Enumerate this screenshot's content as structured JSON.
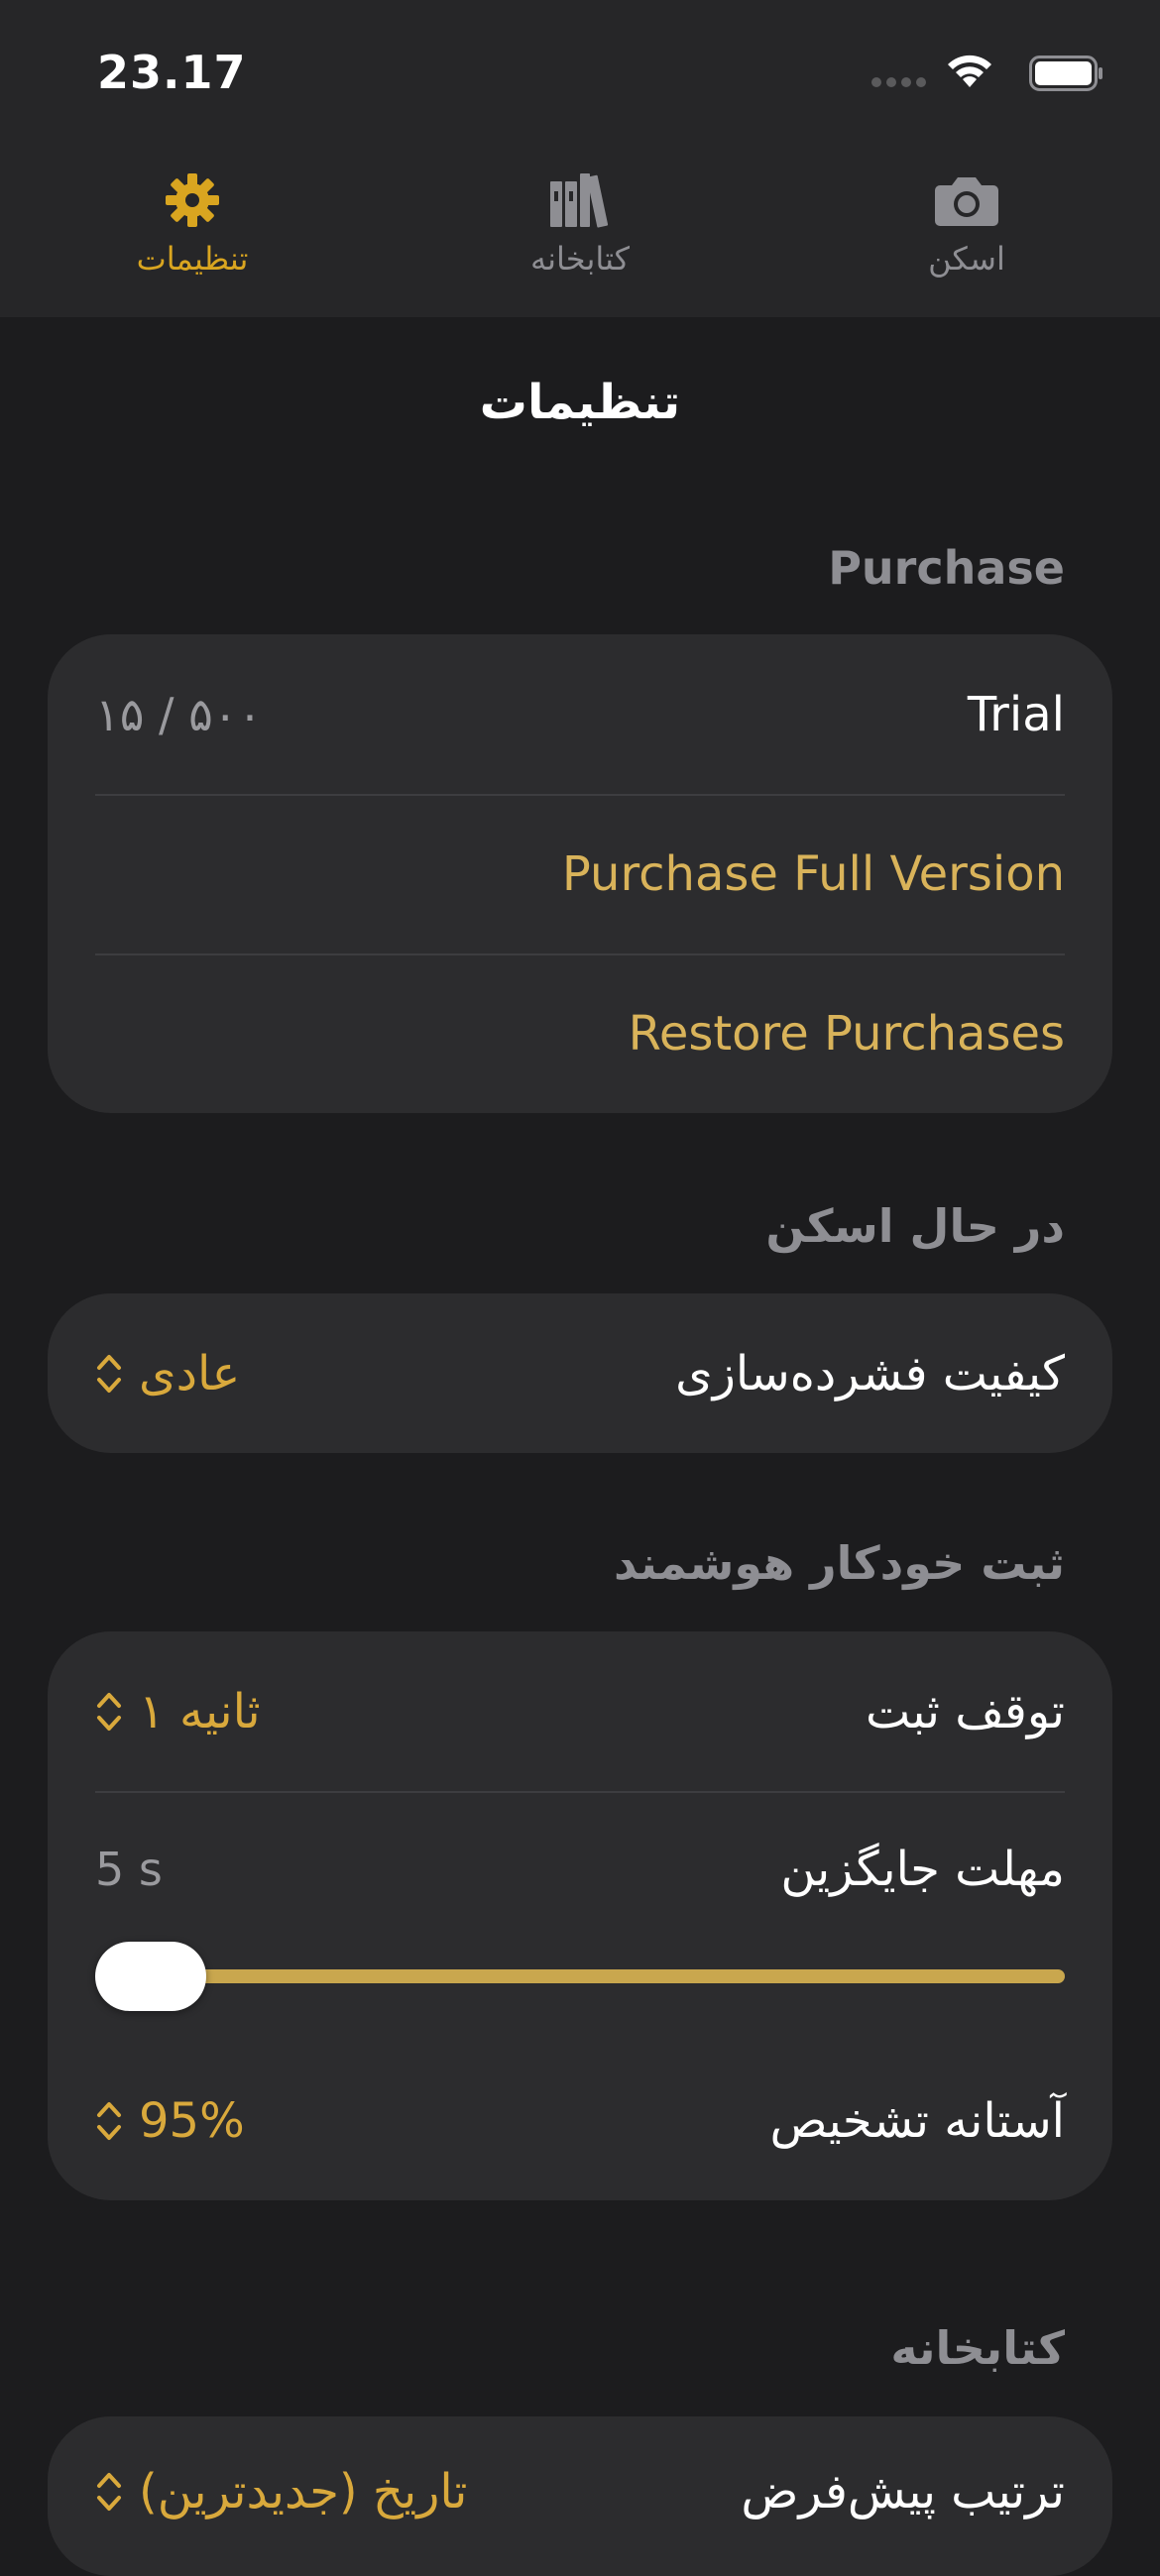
{
  "status_bar": {
    "time": "23.17"
  },
  "tabs": [
    {
      "label": "تنظیمات",
      "icon": "gear-icon",
      "active": true
    },
    {
      "label": "کتابخانه",
      "icon": "books-icon",
      "active": false
    },
    {
      "label": "اسکن",
      "icon": "camera-icon",
      "active": false
    }
  ],
  "page_title": "تنظیمات",
  "purchase": {
    "header": "Purchase",
    "trial_label": "Trial",
    "trial_count": "۱۵ / ۵۰۰",
    "purchase_full": "Purchase Full Version",
    "restore": "Restore Purchases"
  },
  "scanning": {
    "header": "در حال اسکن",
    "compression_label": "کیفیت فشرده‌سازی",
    "compression_value": "عادی"
  },
  "auto_capture": {
    "header": "ثبت خودکار هوشمند",
    "pause_label": "توقف ثبت",
    "pause_value": "۱ ثانیه",
    "replace_label": "مهلت جایگزین",
    "replace_value": "5 s",
    "slider_fraction": 0.0,
    "threshold_label": "آستانه تشخیص",
    "threshold_value": "95%"
  },
  "library": {
    "header": "کتابخانه",
    "sort_label": "ترتیب پیش‌فرض",
    "sort_value": "تاریخ (جدیدترین)"
  },
  "colors": {
    "accent": "#d9a520",
    "background": "#1c1c1e",
    "card": "#2c2c2e"
  }
}
